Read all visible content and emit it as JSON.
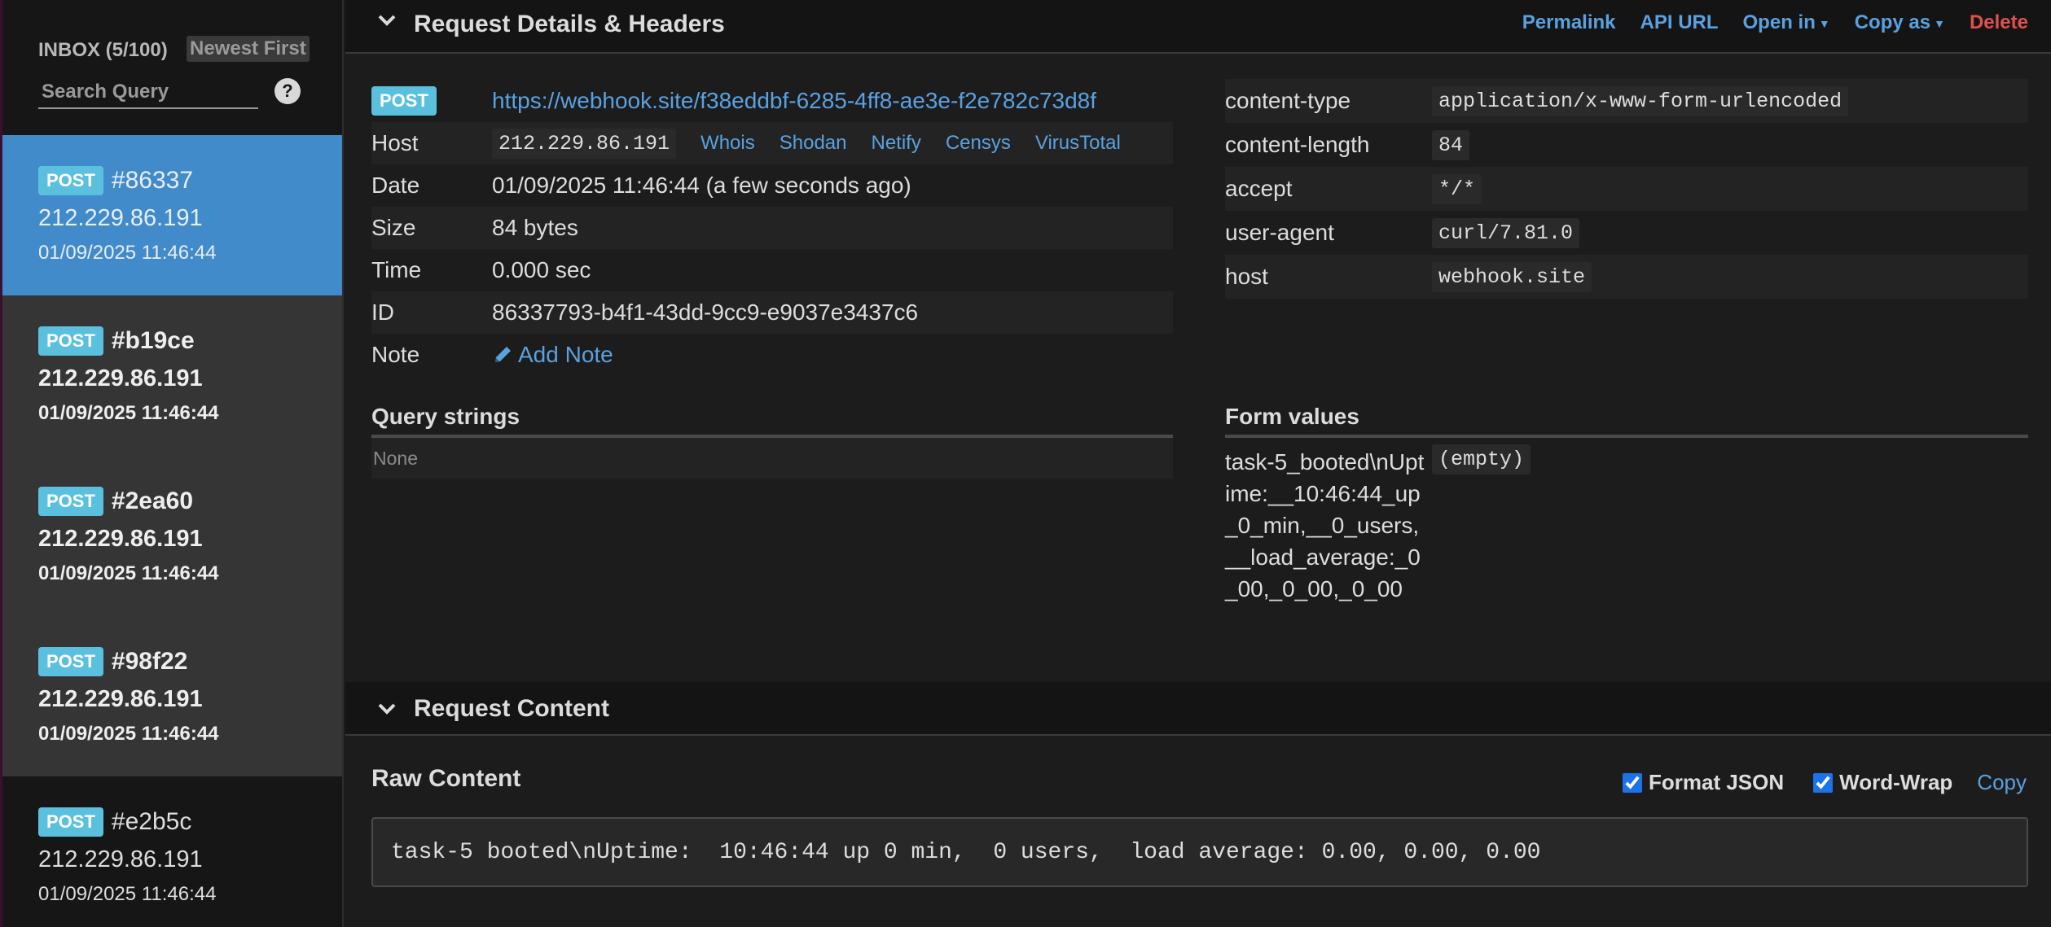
{
  "sidebar": {
    "inbox_label": "INBOX (5/100)",
    "sort_label": "Newest First",
    "search_placeholder": "Search Query",
    "help_glyph": "?",
    "requests": [
      {
        "method": "POST",
        "id": "#86337",
        "ip": "212.229.86.191",
        "date": "01/09/2025 11:46:44",
        "state": "active"
      },
      {
        "method": "POST",
        "id": "#b19ce",
        "ip": "212.229.86.191",
        "date": "01/09/2025 11:46:44",
        "state": "unread"
      },
      {
        "method": "POST",
        "id": "#2ea60",
        "ip": "212.229.86.191",
        "date": "01/09/2025 11:46:44",
        "state": "unread"
      },
      {
        "method": "POST",
        "id": "#98f22",
        "ip": "212.229.86.191",
        "date": "01/09/2025 11:46:44",
        "state": "unread"
      },
      {
        "method": "POST",
        "id": "#e2b5c",
        "ip": "212.229.86.191",
        "date": "01/09/2025 11:46:44",
        "state": "read"
      }
    ]
  },
  "details": {
    "section_title": "Request Details & Headers",
    "actions": {
      "permalink": "Permalink",
      "api_url": "API URL",
      "open_in": "Open in",
      "copy_as": "Copy as",
      "delete": "Delete"
    },
    "method": "POST",
    "url": "https://webhook.site/f38eddbf-6285-4ff8-ae3e-f2e782c73d8f",
    "host_label": "Host",
    "host_value": "212.229.86.191",
    "lookups": [
      "Whois",
      "Shodan",
      "Netify",
      "Censys",
      "VirusTotal"
    ],
    "date_label": "Date",
    "date_value": "01/09/2025 11:46:44 (a few seconds ago)",
    "size_label": "Size",
    "size_value": "84 bytes",
    "time_label": "Time",
    "time_value": "0.000 sec",
    "id_label": "ID",
    "id_value": "86337793-b4f1-43dd-9cc9-e9037e3437c6",
    "note_label": "Note",
    "add_note": "Add Note",
    "headers": [
      {
        "key": "content-type",
        "value": "application/x-www-form-urlencoded"
      },
      {
        "key": "content-length",
        "value": "84"
      },
      {
        "key": "accept",
        "value": "*/*"
      },
      {
        "key": "user-agent",
        "value": "curl/7.81.0"
      },
      {
        "key": "host",
        "value": "webhook.site"
      }
    ],
    "query_title": "Query strings",
    "query_none": "None",
    "form_title": "Form values",
    "form_key": "task-5_booted\\nUptime:__10:46:44_up_0_min,__0_users,__load_average:_0_00,_0_00,_0_00",
    "form_value": "(empty)"
  },
  "content": {
    "section_title": "Request Content",
    "raw_title": "Raw Content",
    "format_json": "Format JSON",
    "word_wrap": "Word-Wrap",
    "copy": "Copy",
    "raw_text": "task-5 booted\\nUptime:  10:46:44 up 0 min,  0 users,  load average: 0.00, 0.00, 0.00"
  }
}
